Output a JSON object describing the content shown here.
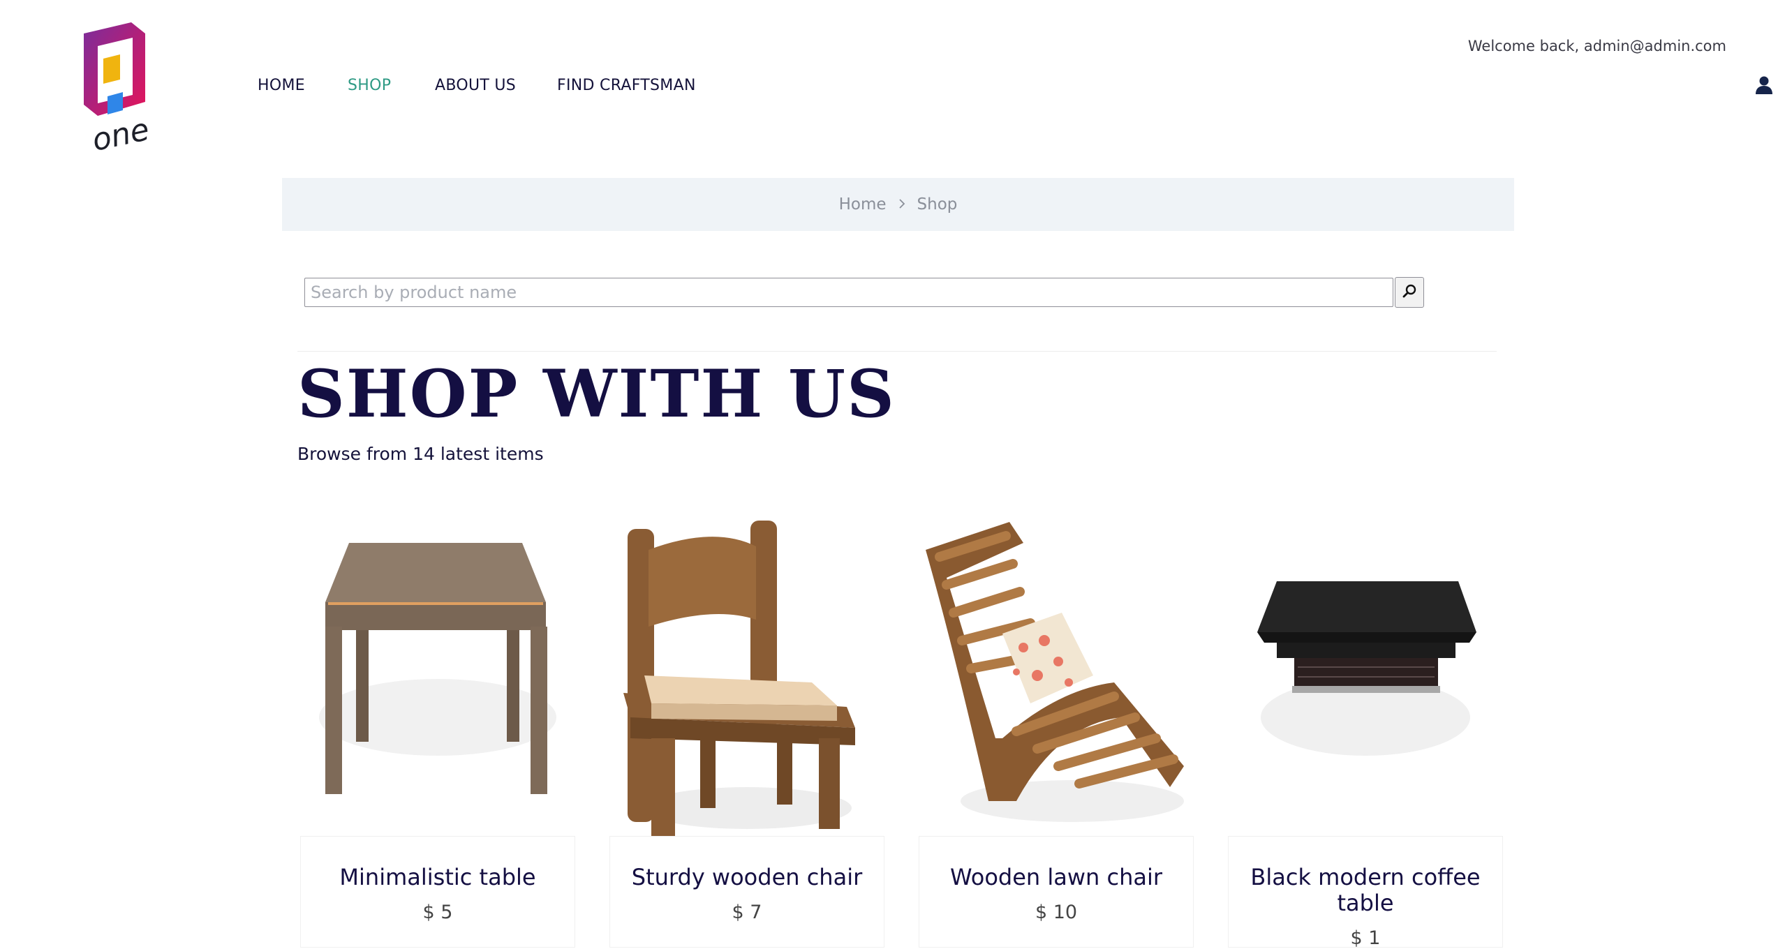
{
  "header": {
    "logo_text": "one",
    "nav": [
      {
        "label": "HOME",
        "active": false
      },
      {
        "label": "SHOP",
        "active": true
      },
      {
        "label": "ABOUT US",
        "active": false
      },
      {
        "label": "FIND CRAFTSMAN",
        "active": false
      }
    ],
    "welcome": "Welcome back, admin@admin.com",
    "user_icon": "user-icon"
  },
  "breadcrumb": {
    "home": "Home",
    "separator": ">",
    "current": "Shop"
  },
  "search": {
    "placeholder": "Search by product name",
    "value": "",
    "icon": "search-icon"
  },
  "shop": {
    "title": "SHOP WITH US",
    "subtitle": "Browse from 14 latest items"
  },
  "products": [
    {
      "name": "Minimalistic table",
      "price": "$ 5",
      "image": "table-image"
    },
    {
      "name": "Sturdy wooden chair",
      "price": "$ 7",
      "image": "chair-image"
    },
    {
      "name": "Wooden lawn chair",
      "price": "$ 10",
      "image": "lawn-chair-image"
    },
    {
      "name": "Black modern coffee table",
      "price": "$ 1",
      "image": "coffee-table-image"
    }
  ],
  "colors": {
    "accent": "#2e9a84",
    "title": "#140f42",
    "breadcrumb_bg": "#eff3f7"
  }
}
